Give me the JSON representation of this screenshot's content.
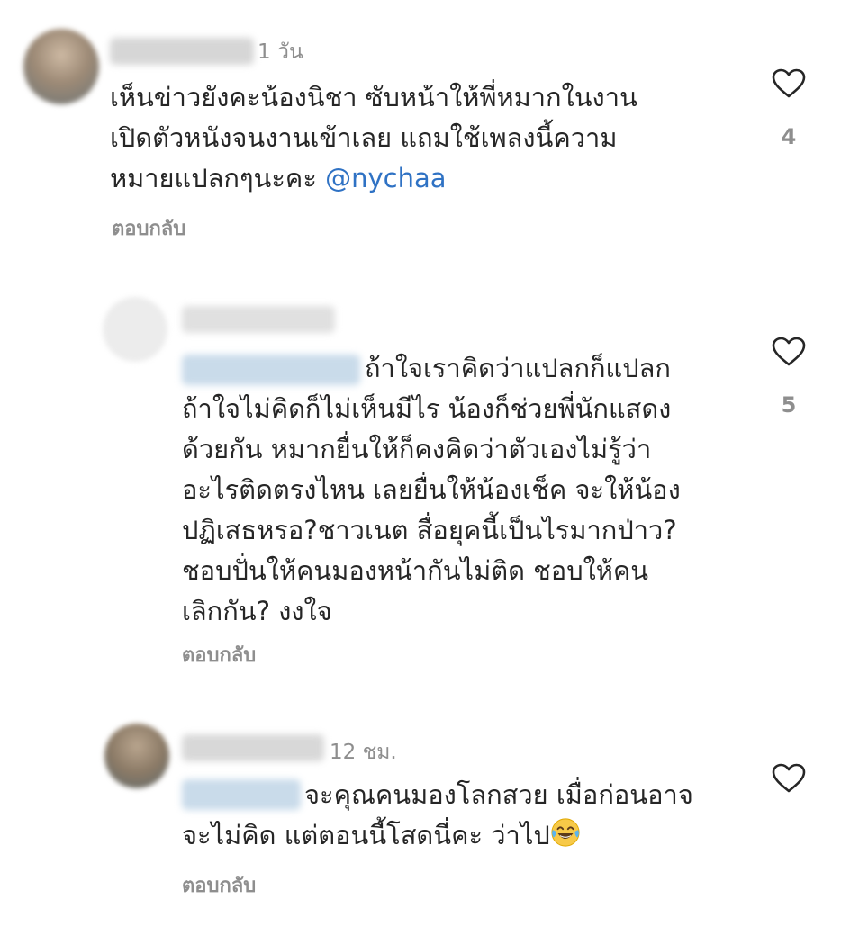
{
  "comments": [
    {
      "time": "1 วัน",
      "lines": [
        "เห็นข่าวยังคะน้องนิชา ซับหน้าให้พี่หมากในงาน",
        "เปิดตัวหนังจนงานเข้าเลย แถมใช้เพลงนี้ความ",
        "หมายแปลกๆนะคะ"
      ],
      "mention": "@nychaa",
      "reply_label": "ตอบกลับ",
      "likes": "4"
    },
    {
      "time": "",
      "lines": [
        "ถ้าใจเราคิดว่าแปลกก็แปลก",
        "ถ้าใจไม่คิดก็ไม่เห็นมีไร น้องก็ช่วยพี่นักแสดง",
        "ด้วยกัน หมากยื่นให้ก็คงคิดว่าตัวเองไม่รู้ว่า",
        "อะไรติดตรงไหน เลยยื่นให้น้องเช็ค จะให้น้อง",
        "ปฏิเสธหรอ?ชาวเนต สื่อยุคนี้เป็นไรมากป่าว?",
        "ชอบปั่นให้คนมองหน้ากันไม่ติด ชอบให้คน",
        "เลิกกัน? งงใจ"
      ],
      "reply_label": "ตอบกลับ",
      "likes": "5"
    },
    {
      "time": "12 ชม.",
      "lines": [
        "จะคุณคนมองโลกสวย เมื่อก่อนอาจ",
        "จะไม่คิด แต่ตอนนี้โสดนี่คะ ว่าไป"
      ],
      "emoji": "face-with-tears-of-joy",
      "reply_label": "ตอบกลับ",
      "likes": ""
    }
  ],
  "colors": {
    "text": "#262626",
    "muted": "#8e8e8e",
    "mention": "#2f72c4",
    "background": "#ffffff"
  }
}
